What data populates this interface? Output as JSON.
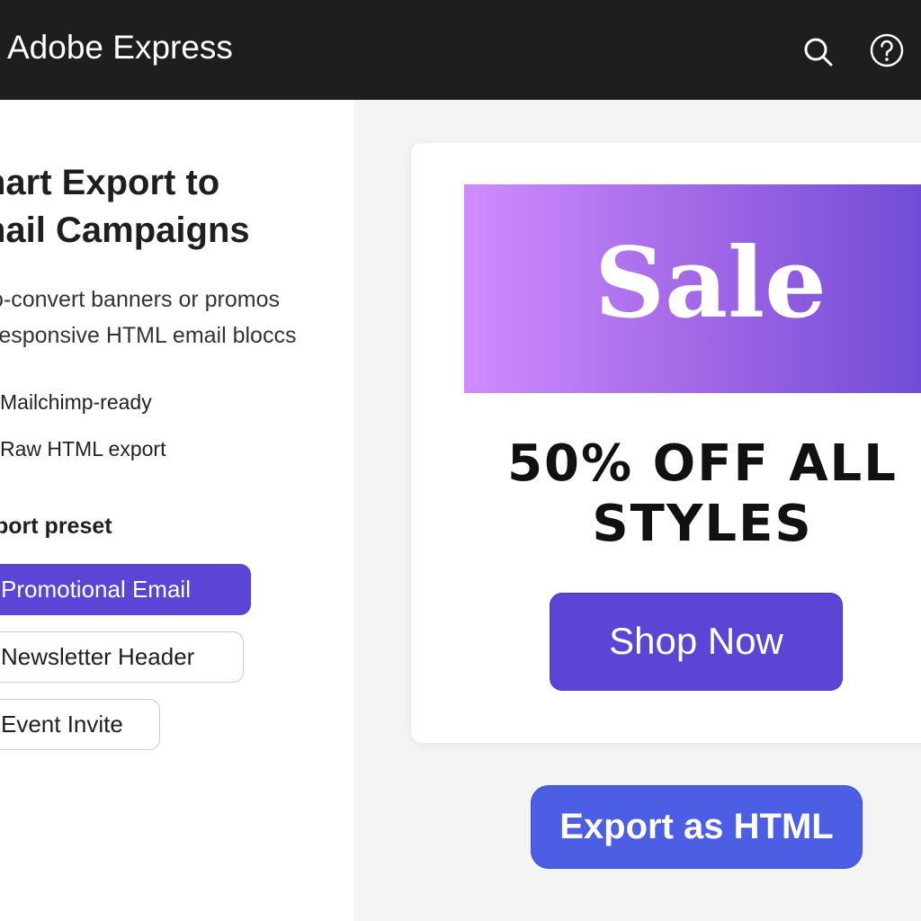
{
  "app": {
    "title": "Adobe Express"
  },
  "header": {
    "search_icon": "search-icon",
    "help_icon": "help-icon"
  },
  "panel": {
    "title_line1": "nart Export to",
    "title_line2": "nail Campaigns",
    "description_line1": "o-convert banners or promos",
    "description_line2": "responsive HTML email blocсs",
    "features": [
      "Mailchimp-ready",
      "Raw HTML export"
    ],
    "preset_heading": "port preset",
    "presets": [
      {
        "label": "Promotional Email",
        "selected": true
      },
      {
        "label": "Newsletter Header",
        "selected": false
      },
      {
        "label": "Event Invite",
        "selected": false
      }
    ]
  },
  "preview": {
    "banner_text": "Sale",
    "headline_line1": "50% OFF ALL",
    "headline_line2": "STYLES",
    "cta_label": "Shop Now"
  },
  "actions": {
    "export_label": "Export as HTML"
  },
  "colors": {
    "topbar": "#1e1e1e",
    "accent": "#5a45d6",
    "export_button": "#4c5ee3",
    "banner_start": "#d08cff",
    "banner_end": "#6f4bd6",
    "canvas_background": "#f4f4f4"
  }
}
